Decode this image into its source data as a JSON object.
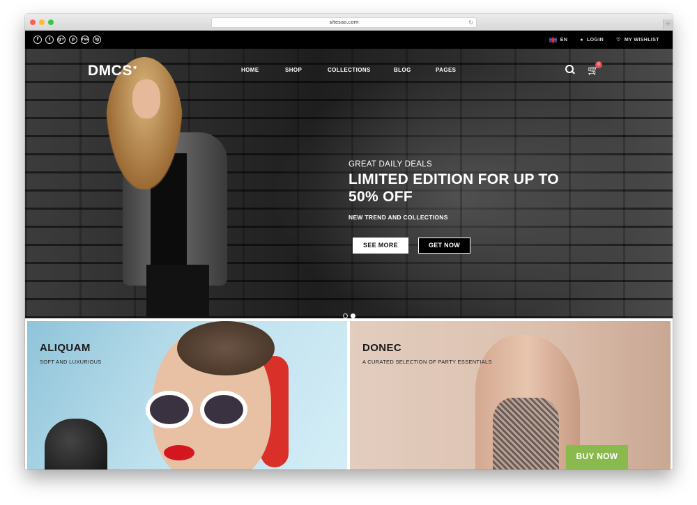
{
  "browser": {
    "url": "sitesao.com",
    "new_tab_label": "+"
  },
  "topbar": {
    "social_icons": [
      "facebook-icon",
      "twitter-icon",
      "google-plus-icon",
      "pinterest-icon",
      "rss-icon",
      "instagram-icon"
    ],
    "social_glyphs": [
      "f",
      "t",
      "g+",
      "p",
      "rss",
      "ig"
    ],
    "language": "EN",
    "login": "LOGIN",
    "wishlist": "MY WISHLIST"
  },
  "nav": {
    "logo": "DMCS",
    "logo_mark": "♥",
    "menu": [
      "HOME",
      "SHOP",
      "COLLECTIONS",
      "BLOG",
      "PAGES"
    ],
    "cart_count": "0",
    "cart_glyph": "🛒"
  },
  "hero": {
    "kicker": "GREAT DAILY DEALS",
    "headline": "LIMITED EDITION FOR UP TO 50% OFF",
    "subheadline": "NEW TREND AND COLLECTIONS",
    "see_more_label": "SEE MORE",
    "get_now_label": "GET NOW",
    "slides_total": 2,
    "slide_active": 2
  },
  "promos": [
    {
      "title": "ALIQUAM",
      "subtitle": "SOFT AND LUXURIOUS"
    },
    {
      "title": "DONEC",
      "subtitle": "A CURATED SELECTION OF PARTY ESSENTIALS",
      "button_label": "BUY NOW"
    }
  ],
  "colors": {
    "accent_green": "#8ab94e",
    "cart_badge": "#e8505b",
    "topbar_bg": "#000000"
  }
}
